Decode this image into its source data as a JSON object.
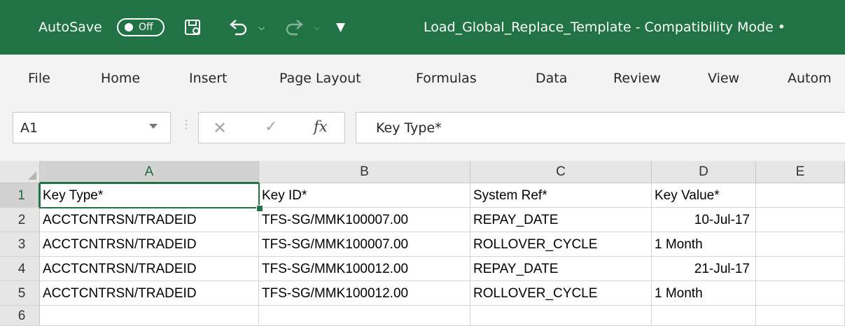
{
  "titlebar": {
    "autosave_label": "AutoSave",
    "autosave_state": "Off",
    "document_title": "Load_Global_Replace_Template  -  Compatibility Mode  •",
    "bg_color": "#217346"
  },
  "ribbon": {
    "tabs": [
      "File",
      "Home",
      "Insert",
      "Page Layout",
      "Formulas",
      "Data",
      "Review",
      "View",
      "Autom"
    ]
  },
  "formula_bar": {
    "name_box": "A1",
    "fx_label": "fx",
    "formula": "Key Type*"
  },
  "sheet": {
    "columns": [
      "A",
      "B",
      "C",
      "D",
      "E"
    ],
    "rows": [
      "1",
      "2",
      "3",
      "4",
      "5",
      "6"
    ],
    "cells": [
      [
        "Key Type*",
        "Key ID*",
        "System Ref*",
        "Key Value*",
        ""
      ],
      [
        "ACCTCNTRSN/TRADEID",
        "TFS-SG/MMK100007.00",
        "REPAY_DATE",
        "10-Jul-17",
        ""
      ],
      [
        "ACCTCNTRSN/TRADEID",
        "TFS-SG/MMK100007.00",
        "ROLLOVER_CYCLE",
        "1 Month",
        ""
      ],
      [
        "ACCTCNTRSN/TRADEID",
        "TFS-SG/MMK100012.00",
        "REPAY_DATE",
        "21-Jul-17",
        ""
      ],
      [
        "ACCTCNTRSN/TRADEID",
        "TFS-SG/MMK100012.00",
        "ROLLOVER_CYCLE",
        "1 Month",
        ""
      ],
      [
        "",
        "",
        "",
        "",
        ""
      ]
    ],
    "selected_cell": "A1",
    "accent_color": "#217346"
  }
}
